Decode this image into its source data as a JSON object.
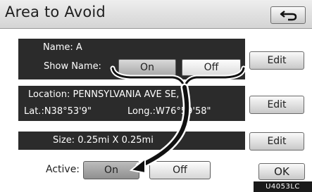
{
  "header": {
    "title": "Area to Avoid",
    "back_icon": "back-arrow-icon"
  },
  "name_panel": {
    "name_line": "Name: A",
    "show_name_label": "Show Name:",
    "on_label": "On",
    "off_label": "Off",
    "edit_label": "Edit"
  },
  "location_panel": {
    "location_line": "Location: PENNSYLVANIA AVE SE, ...",
    "lat_line": "Lat.:N38°53'9\"",
    "long_line": "Long.:W76°59'58\"",
    "edit_label": "Edit"
  },
  "size_panel": {
    "size_line": "Size: 0.25mi X 0.25mi",
    "edit_label": "Edit"
  },
  "active": {
    "label": "Active:",
    "on_label": "On",
    "off_label": "Off"
  },
  "ok_label": "OK",
  "figure_code": "U4053LC"
}
